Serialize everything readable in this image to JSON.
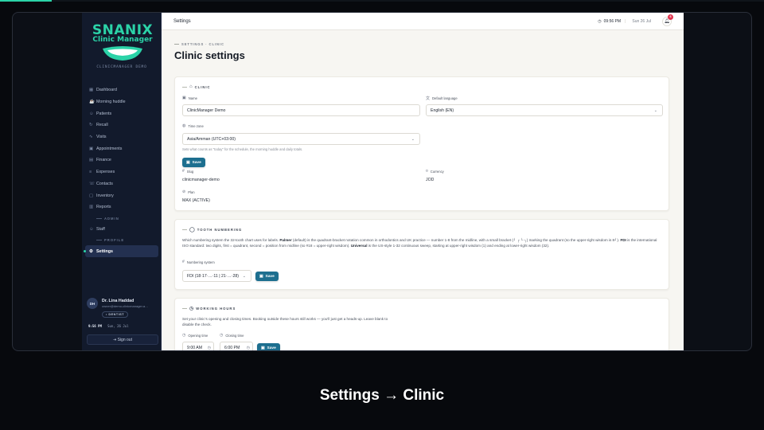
{
  "video": {
    "progress_fraction": 0.068,
    "caption": "Settings → Clinic",
    "accent": "#2bd3a8"
  },
  "brand": {
    "name": "SNANIX",
    "product": "Clinic Manager",
    "workspace": "CLINICMANAGER DEMO"
  },
  "sidebar": {
    "items": [
      {
        "label": "Dashboard",
        "icon": "dashboard-icon",
        "glyph": "▦"
      },
      {
        "label": "Morning huddle",
        "icon": "coffee-icon",
        "glyph": "☕"
      },
      {
        "label": "Patients",
        "icon": "users-icon",
        "glyph": "☺"
      },
      {
        "label": "Recall",
        "icon": "refresh-icon",
        "glyph": "↻"
      },
      {
        "label": "Visits",
        "icon": "pulse-icon",
        "glyph": "∿"
      },
      {
        "label": "Appointments",
        "icon": "calendar-icon",
        "glyph": "▣"
      },
      {
        "label": "Finance",
        "icon": "wallet-icon",
        "glyph": "▤"
      },
      {
        "label": "Expenses",
        "icon": "receipt-icon",
        "glyph": "≡"
      },
      {
        "label": "Contacts",
        "icon": "contact-icon",
        "glyph": "☏"
      },
      {
        "label": "Inventory",
        "icon": "box-icon",
        "glyph": "▢"
      },
      {
        "label": "Reports",
        "icon": "chart-icon",
        "glyph": "▥"
      }
    ],
    "admin_section": "ADMIN",
    "admin_items": [
      {
        "label": "Staff",
        "icon": "staff-icon",
        "glyph": "☺"
      }
    ],
    "profile_section": "PROFILE",
    "profile_items": [
      {
        "label": "Settings",
        "icon": "gear-icon",
        "glyph": "⚙"
      }
    ]
  },
  "user": {
    "initials": "DH",
    "name": "Dr. Lina Haddad",
    "email": "owner@demo-clinicmanager.a…",
    "role": "• DENTIST",
    "time": "9:56 PM",
    "date": "Sun, 26 Jul",
    "signout": "Sign out"
  },
  "topbar": {
    "page": "Settings",
    "time": "09:56 PM",
    "date": "Sun 26 Jul",
    "notifications": "6"
  },
  "page": {
    "breadcrumb": "SETTINGS · CLINIC",
    "title": "Clinic settings"
  },
  "clinic_card": {
    "heading": "CLINIC",
    "name_label": "Name",
    "name_value": "ClinicManager Demo",
    "language_label": "Default language",
    "language_value": "English (EN)",
    "timezone_label": "Time zone",
    "timezone_value": "Asia/Amman (UTC+03:00)",
    "timezone_help": "Sets what counts as \"today\" for the schedule, the morning huddle and daily totals.",
    "save": "Save",
    "slug_label": "Slug",
    "slug_value": "clinicmanager-demo",
    "currency_label": "Currency",
    "currency_value": "JOD",
    "plan_label": "Plan",
    "plan_value": "MAX (ACTIVE)"
  },
  "tooth_card": {
    "heading": "TOOTH NUMBERING",
    "p1": "Which numbering system the 32-tooth chart uses for labels. ",
    "p1_bold1": "Palmer",
    "p2": " (default) is the quadrant-bracket notation common in orthodontics and UK practice — number 1-8 from the midline, with a small bracket (┘ ┌ └ ┐) marking the quadrant (so the upper-right wisdom is 8┘). ",
    "p2_bold2": "FDI",
    "p3": " is the international ISO standard: two digits, first = quadrant, second = position from midline (so #18 = upper-right wisdom). ",
    "p3_bold3": "Universal",
    "p4": " is the US-style 1-32 continuous sweep, starting at upper-right wisdom (1) and ending at lower-right wisdom (32).",
    "system_label": "Numbering system",
    "system_value": "FDI (18·17·…·11 | 21·…·28)",
    "save": "Save"
  },
  "hours_card": {
    "heading": "WORKING HOURS",
    "help": "Set your clinic's opening and closing times. Booking outside these hours still works — you'll just get a heads-up. Leave blank to disable the check.",
    "opening_label": "Opening time",
    "opening_value": "9:00 AM",
    "closing_label": "Closing time",
    "closing_value": "6:00 PM",
    "save": "Save"
  }
}
